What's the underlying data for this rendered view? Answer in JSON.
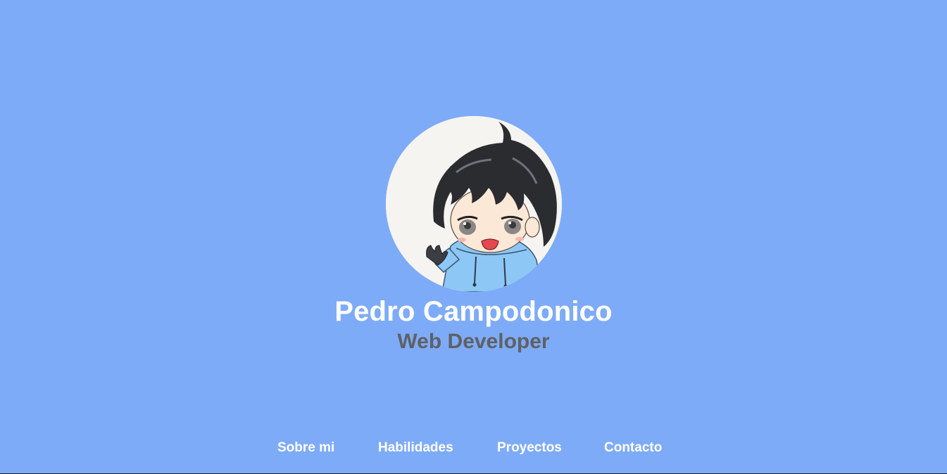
{
  "profile": {
    "avatar_icon": "cartoon-boy-avatar",
    "name": "Pedro Campodonico",
    "role": "Web Developer"
  },
  "nav": {
    "items": [
      {
        "label": "Sobre mi"
      },
      {
        "label": "Habilidades"
      },
      {
        "label": "Proyectos"
      },
      {
        "label": "Contacto"
      }
    ]
  },
  "colors": {
    "background": "#7eabf7",
    "name_text": "#ffffff",
    "role_text": "#5e6166",
    "nav_text": "#ffffff"
  }
}
